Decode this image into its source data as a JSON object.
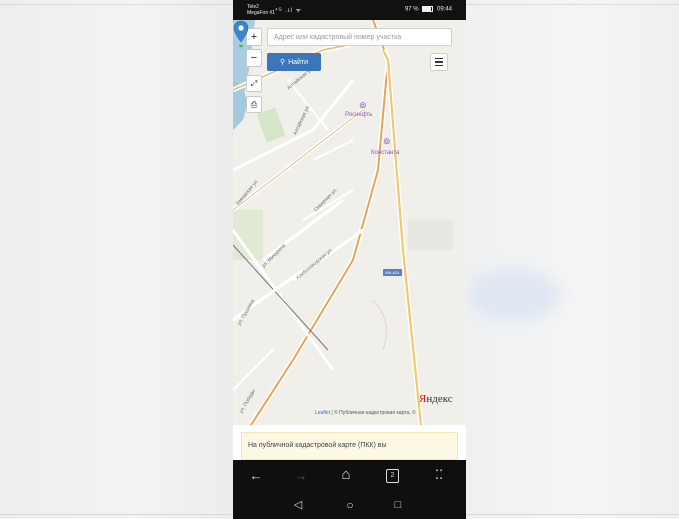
{
  "status_bar": {
    "operator_line1": "Tele2",
    "operator_line2": "MegaFon #1",
    "signal": "⁴ᴳ .ıl ᯤ",
    "battery": "97 %",
    "time": "09:44"
  },
  "map": {
    "search_placeholder": "Адрес или кадастровый номер участка",
    "find_label": "Найти",
    "zoom_in": "+",
    "zoom_out": "−",
    "poi": [
      {
        "name": "Роснефть"
      },
      {
        "name": "Константа"
      }
    ],
    "streets": [
      "Алтайская ул.",
      "Алтайская ул.",
      "Заводская ул.",
      "Северная ул.",
      "ул. Мичурина",
      "Хлебозаводская ул.",
      "ул. Пушкина",
      "ул. Победы"
    ],
    "road_badge": "ИЖ-631",
    "yandex_logo_first": "Я",
    "yandex_logo_rest": "ндекс",
    "attribution_leaflet": "Leaflet",
    "attribution_rest": " | © Публичная кадастровая карта, ©"
  },
  "info": {
    "text": "На публичной кадастровой карте (ПКК) вы"
  },
  "navbar": {
    "back": "←",
    "forward": "→",
    "home": "⌂",
    "tabs_count": "2",
    "menu": "⁚⁚",
    "sys_back": "◁",
    "sys_home": "○",
    "sys_recent": "□"
  },
  "colors": {
    "accent": "#3a76b9",
    "pin": "#3a86c8",
    "road": "#e2aa5a"
  }
}
